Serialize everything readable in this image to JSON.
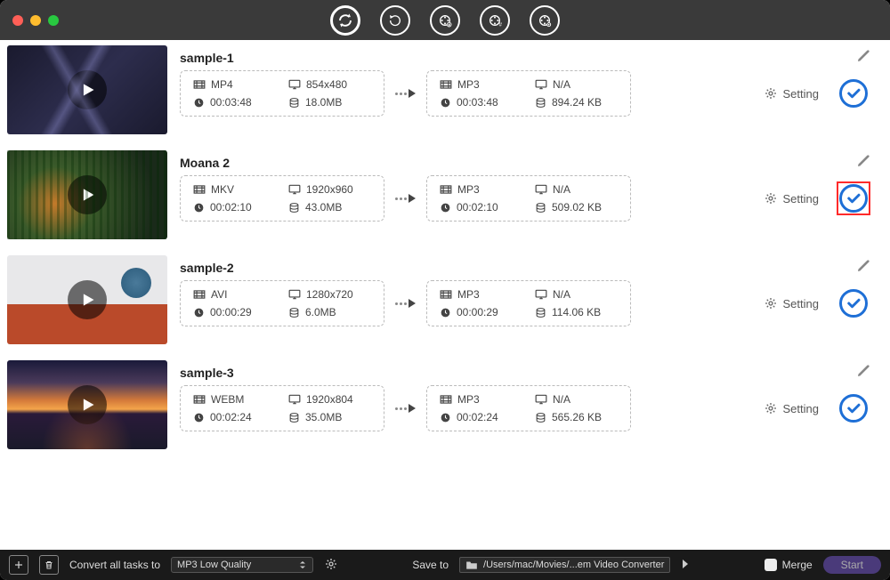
{
  "bottombar": {
    "convert_label": "Convert all tasks to",
    "convert_selected": "MP3 Low Quality",
    "save_to_label": "Save to",
    "save_to_path": "/Users/mac/Movies/...em Video Converter",
    "merge_label": "Merge",
    "start_label": "Start"
  },
  "items": [
    {
      "title": "sample-1",
      "thumb_class": "t1",
      "src": {
        "format": "MP4",
        "resolution": "854x480",
        "duration": "00:03:48",
        "size": "18.0MB"
      },
      "dst": {
        "format": "MP3",
        "resolution": "N/A",
        "duration": "00:03:48",
        "size": "894.24 KB"
      },
      "setting_label": "Setting",
      "highlight": false
    },
    {
      "title": "Moana 2",
      "thumb_class": "t2",
      "src": {
        "format": "MKV",
        "resolution": "1920x960",
        "duration": "00:02:10",
        "size": "43.0MB"
      },
      "dst": {
        "format": "MP3",
        "resolution": "N/A",
        "duration": "00:02:10",
        "size": "509.02 KB"
      },
      "setting_label": "Setting",
      "highlight": true
    },
    {
      "title": "sample-2",
      "thumb_class": "t3",
      "src": {
        "format": "AVI",
        "resolution": "1280x720",
        "duration": "00:00:29",
        "size": "6.0MB"
      },
      "dst": {
        "format": "MP3",
        "resolution": "N/A",
        "duration": "00:00:29",
        "size": "114.06 KB"
      },
      "setting_label": "Setting",
      "highlight": false
    },
    {
      "title": "sample-3",
      "thumb_class": "t4",
      "src": {
        "format": "WEBM",
        "resolution": "1920x804",
        "duration": "00:02:24",
        "size": "35.0MB"
      },
      "dst": {
        "format": "MP3",
        "resolution": "N/A",
        "duration": "00:02:24",
        "size": "565.26 KB"
      },
      "setting_label": "Setting",
      "highlight": false
    }
  ]
}
